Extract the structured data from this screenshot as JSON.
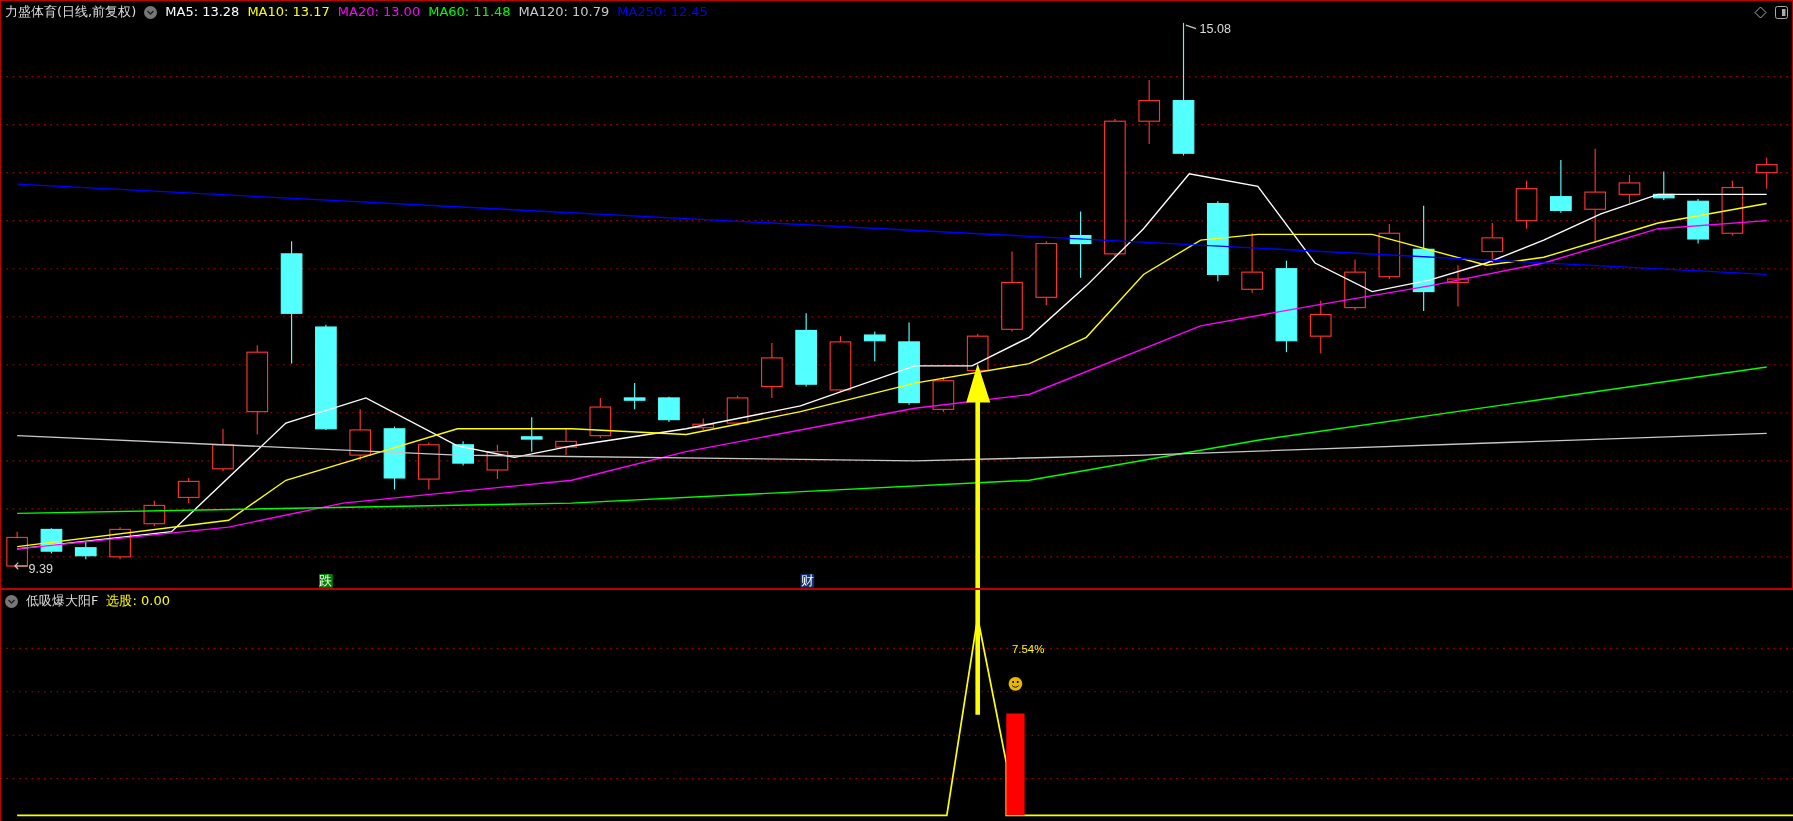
{
  "title_bar": {
    "stock_name": "力盛体育(日线,前复权)",
    "indicators": [
      {
        "label": "MA5: 13.28",
        "color": "#ffffff"
      },
      {
        "label": "MA10: 13.17",
        "color": "#ffff00"
      },
      {
        "label": "MA20: 13.00",
        "color": "#ff00ff"
      },
      {
        "label": "MA60: 11.48",
        "color": "#00ff00"
      },
      {
        "label": "MA120: 10.79",
        "color": "#c8c8c8"
      },
      {
        "label": "MA250: 12.45",
        "color": "#0000ff"
      }
    ]
  },
  "main_chart": {
    "high_label": "15.08",
    "low_label": "9.39",
    "markers": [
      {
        "text": "跌",
        "kind": "down"
      },
      {
        "text": "财",
        "kind": "finance"
      }
    ]
  },
  "indicator_panel": {
    "name": "低吸爆大阳F",
    "readout": "选股: 0.00",
    "signal_label": "7.54%"
  }
}
